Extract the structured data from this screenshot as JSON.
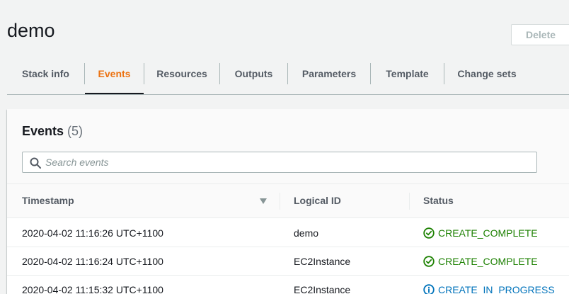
{
  "stack": {
    "name": "demo"
  },
  "actions": {
    "delete_label": "Delete"
  },
  "tabs": [
    {
      "label": "Stack info"
    },
    {
      "label": "Events",
      "active": true
    },
    {
      "label": "Resources"
    },
    {
      "label": "Outputs"
    },
    {
      "label": "Parameters"
    },
    {
      "label": "Template"
    },
    {
      "label": "Change sets"
    }
  ],
  "events": {
    "title": "Events",
    "count": "(5)",
    "search": {
      "placeholder": "Search events",
      "value": ""
    },
    "columns": {
      "timestamp": "Timestamp",
      "logical_id": "Logical ID",
      "status": "Status"
    },
    "rows": [
      {
        "timestamp": "2020-04-02 11:16:26 UTC+1100",
        "logical_id": "demo",
        "status": "CREATE_COMPLETE"
      },
      {
        "timestamp": "2020-04-02 11:16:24 UTC+1100",
        "logical_id": "EC2Instance",
        "status": "CREATE_COMPLETE"
      },
      {
        "timestamp": "2020-04-02 11:15:32 UTC+1100",
        "logical_id": "EC2Instance",
        "status": "CREATE_IN_PROGRESS"
      }
    ]
  },
  "colors": {
    "accent": "#ec7211",
    "success": "#1d8102",
    "info": "#0073bb",
    "disabled": "#aab7b8"
  },
  "icons": {
    "complete": "check-circle-icon",
    "in_progress": "info-circle-icon",
    "search": "search-icon",
    "sort": "caret-down-icon"
  }
}
